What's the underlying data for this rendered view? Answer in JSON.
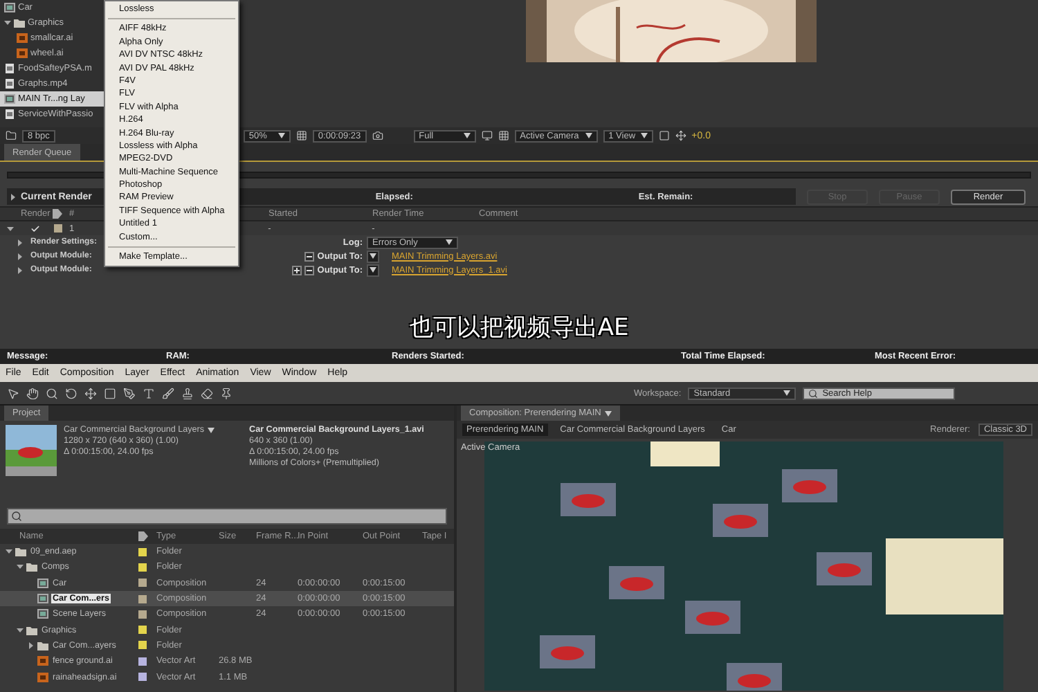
{
  "top_window": {
    "project_items": [
      {
        "name": "Car",
        "kind": "comp",
        "selected": false
      },
      {
        "name": "Graphics",
        "kind": "folder",
        "selected": false,
        "expanded": true,
        "children": [
          {
            "name": "smallcar.ai",
            "kind": "ai",
            "selected": false
          },
          {
            "name": "wheel.ai",
            "kind": "ai",
            "selected": false
          }
        ]
      },
      {
        "name": "FoodSafteyPSA.m",
        "kind": "file",
        "selected": false
      },
      {
        "name": "Graphs.mp4",
        "kind": "file",
        "selected": false
      },
      {
        "name": "MAIN Tr...ng Lay",
        "kind": "comp",
        "selected": true
      },
      {
        "name": "ServiceWithPassio",
        "kind": "file",
        "selected": false
      }
    ],
    "bpc": "8 bpc",
    "format_menu": [
      {
        "kind": "item",
        "label": "Lossless"
      },
      {
        "kind": "separator"
      },
      {
        "kind": "item",
        "label": "AIFF 48kHz"
      },
      {
        "kind": "item",
        "label": "Alpha Only"
      },
      {
        "kind": "item",
        "label": "AVI DV NTSC 48kHz"
      },
      {
        "kind": "item",
        "label": "AVI DV PAL 48kHz"
      },
      {
        "kind": "item",
        "label": "F4V"
      },
      {
        "kind": "item",
        "label": "FLV"
      },
      {
        "kind": "item",
        "label": "FLV with Alpha"
      },
      {
        "kind": "item",
        "label": "H.264"
      },
      {
        "kind": "item",
        "label": "H.264 Blu-ray"
      },
      {
        "kind": "item",
        "label": "Lossless with Alpha"
      },
      {
        "kind": "item",
        "label": "MPEG2-DVD"
      },
      {
        "kind": "item",
        "label": "Multi-Machine Sequence"
      },
      {
        "kind": "item",
        "label": "Photoshop"
      },
      {
        "kind": "item",
        "label": "RAM Preview"
      },
      {
        "kind": "item",
        "label": "TIFF Sequence with Alpha"
      },
      {
        "kind": "item",
        "label": "Untitled 1"
      },
      {
        "kind": "item",
        "label": "Custom..."
      },
      {
        "kind": "separator"
      },
      {
        "kind": "item",
        "label": "Make Template..."
      }
    ],
    "viewer_toolbar": {
      "zoom": "50%",
      "timecode": "0:00:09:23",
      "resolution": "Full",
      "view": "Active Camera",
      "layout": "1 View",
      "exposure": "+0.0"
    },
    "render_queue": {
      "tab": "Render Queue",
      "current_render": "Current Render",
      "elapsed_label": "Elapsed:",
      "remain_label": "Est. Remain:",
      "buttons": [
        {
          "label": "Stop",
          "disabled": true
        },
        {
          "label": "Pause",
          "disabled": true
        },
        {
          "label": "Render",
          "disabled": false
        }
      ],
      "columns": [
        "Render",
        "#",
        "Started",
        "Render Time",
        "Comment"
      ],
      "item": {
        "number": "1",
        "checked": true,
        "expanded": true,
        "started": "-",
        "render_time": "-"
      },
      "sub_rows": [
        {
          "kind": "dropdown",
          "label": "Render Settings:",
          "control_label": "Log:",
          "value": "Errors Only"
        },
        {
          "kind": "output",
          "label": "Output Module:",
          "control_label": "Output To:",
          "value": "MAIN Trimming Layers.avi"
        },
        {
          "kind": "output_add",
          "label": "Output Module:",
          "control_label": "Output To:",
          "value": "MAIN Trimming Layers_1.avi"
        }
      ]
    },
    "status_bar": [
      "Message:",
      "RAM:",
      "Renders Started:",
      "Total Time Elapsed:",
      "Most Recent Error:"
    ]
  },
  "subtitle": "也可以把视频导出AE",
  "bottom_window": {
    "menu": [
      "File",
      "Edit",
      "Composition",
      "Layer",
      "Effect",
      "Animation",
      "View",
      "Window",
      "Help"
    ],
    "workspace_label": "Workspace:",
    "workspace": "Standard",
    "search": {
      "placeholder": "Search Help"
    },
    "project": {
      "tab": "Project",
      "comp_info": {
        "title": "Car Commercial Background Layers",
        "lines": [
          "1280 x 720  (640 x 360) (1.00)",
          "Δ 0:00:15:00, 24.00 fps"
        ]
      },
      "footage_info": {
        "title": "Car Commercial Background Layers_1.avi",
        "lines": [
          "640 x 360 (1.00)",
          "Δ 0:00:15:00, 24.00 fps",
          "Millions of Colors+ (Premultiplied)"
        ]
      },
      "columns": [
        "Name",
        "Type",
        "Size",
        "Frame R...",
        "In Point",
        "Out Point",
        "Tape I"
      ],
      "files": [
        {
          "name": "09_end.aep",
          "kind": "folder",
          "type": "Folder",
          "color": "#e3d44c",
          "expanded": true,
          "selected": false,
          "children": [
            {
              "name": "Comps",
              "kind": "folder",
              "type": "Folder",
              "color": "#e3d44c",
              "expanded": true,
              "selected": false,
              "children": [
                {
                  "name": "Car",
                  "kind": "comp",
                  "type": "Composition",
                  "color": "#b5a98e",
                  "frame_rate": "24",
                  "in_point": "0:00:00:00",
                  "out_point": "0:00:15:00",
                  "selected": false
                },
                {
                  "name": "Car Com...ers",
                  "kind": "comp",
                  "type": "Composition",
                  "color": "#b5a98e",
                  "frame_rate": "24",
                  "in_point": "0:00:00:00",
                  "out_point": "0:00:15:00",
                  "selected": true
                },
                {
                  "name": "Scene Layers",
                  "kind": "comp",
                  "type": "Composition",
                  "color": "#b5a98e",
                  "frame_rate": "24",
                  "in_point": "0:00:00:00",
                  "out_point": "0:00:15:00",
                  "selected": false
                }
              ]
            },
            {
              "name": "Graphics",
              "kind": "folder",
              "type": "Folder",
              "color": "#e3d44c",
              "expanded": true,
              "selected": false,
              "children": [
                {
                  "name": "Car Com...ayers",
                  "kind": "folder",
                  "type": "Folder",
                  "color": "#e3d44c",
                  "expanded": false,
                  "selected": false
                },
                {
                  "name": "fence ground.ai",
                  "kind": "ai",
                  "type": "Vector Art",
                  "color": "#b7b4e0",
                  "size": "26.8 MB",
                  "selected": false
                },
                {
                  "name": "rainaheadsign.ai",
                  "kind": "ai",
                  "type": "Vector Art",
                  "color": "#b7b4e0",
                  "size": "1.1 MB",
                  "selected": false
                }
              ]
            }
          ]
        }
      ]
    },
    "composition": {
      "tab": "Composition: Prerendering MAIN",
      "breadcrumbs": [
        {
          "label": "Prerendering MAIN",
          "selected": true
        },
        {
          "label": "Car Commercial Background Layers",
          "selected": false
        },
        {
          "label": "Car",
          "selected": false
        }
      ],
      "renderer_label": "Renderer:",
      "renderer": "Classic 3D",
      "view_label": "Active Camera"
    }
  }
}
